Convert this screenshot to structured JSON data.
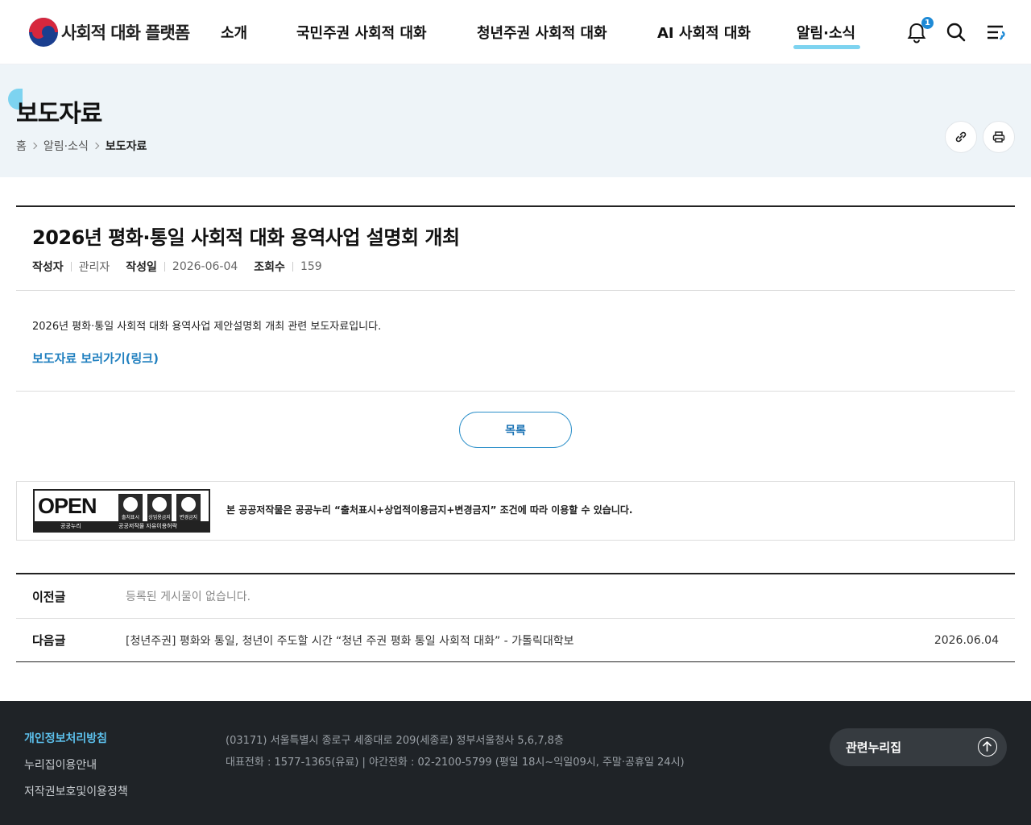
{
  "header": {
    "logo_text": "사회적 대화 플랫폼",
    "nav": [
      "소개",
      "국민주권 사회적 대화",
      "청년주권 사회적 대화",
      "AI 사회적 대화",
      "알림·소식"
    ],
    "active_nav": "알림·소식",
    "notification_count": "1",
    "icons": [
      "bell-icon",
      "search-icon",
      "menu-icon"
    ]
  },
  "subheader": {
    "title": "보도자료",
    "breadcrumb": [
      "홈",
      "알림·소식",
      "보도자료"
    ],
    "actions": [
      "link-icon",
      "print-icon"
    ]
  },
  "post": {
    "title": "2026년 평화·통일 사회적 대화 용역사업 설명회 개최",
    "author_label": "작성자",
    "author": "관리자",
    "date_label": "작성일",
    "date": "2026-06-04",
    "views_label": "조회수",
    "views": "159",
    "body": "2026년 평화·통일 사회적 대화 용역사업 제안설명회 개최 관련 보도자료입니다.",
    "link_text": "보도자료 보러가기(링크)",
    "list_button": "목록"
  },
  "license": {
    "badge_open": "OPEN",
    "badge_left": "공공누리",
    "badge_right": "공공저작물 자유이용허락",
    "badge_icons": [
      "출처표시",
      "상업용금지",
      "변경금지"
    ],
    "text": "본 공공저작물은 공공누리 “출처표시+상업적이용금지+변경금지” 조건에 따라 이용할 수 있습니다."
  },
  "nav_posts": {
    "prev_label": "이전글",
    "prev_text": "등록된 게시물이 없습니다.",
    "next_label": "다음글",
    "next_text": "[청년주권] 평화와 통일, 청년이 주도할 시간 “청년 주권 평화 통일 사회적 대화” - 가톨릭대학보",
    "next_date": "2026.06.04"
  },
  "footer": {
    "links": [
      "개인정보처리방침",
      "누리집이용안내",
      "저작권보호및이용정책"
    ],
    "address": "(03171) 서울특별시 종로구 세종대로 209(세종로) 정부서울청사 5,6,7,8층",
    "phone": "대표전화 : 1577-1365(유료)  |  야간전화 : 02-2100-5799 (평일 18시~익일09시, 주말·공휴일 24시)",
    "related_label": "관련누리집"
  },
  "colors": {
    "accent": "#7dd3f0",
    "link": "#1f7fbf",
    "footer_bg": "#1f2327"
  }
}
